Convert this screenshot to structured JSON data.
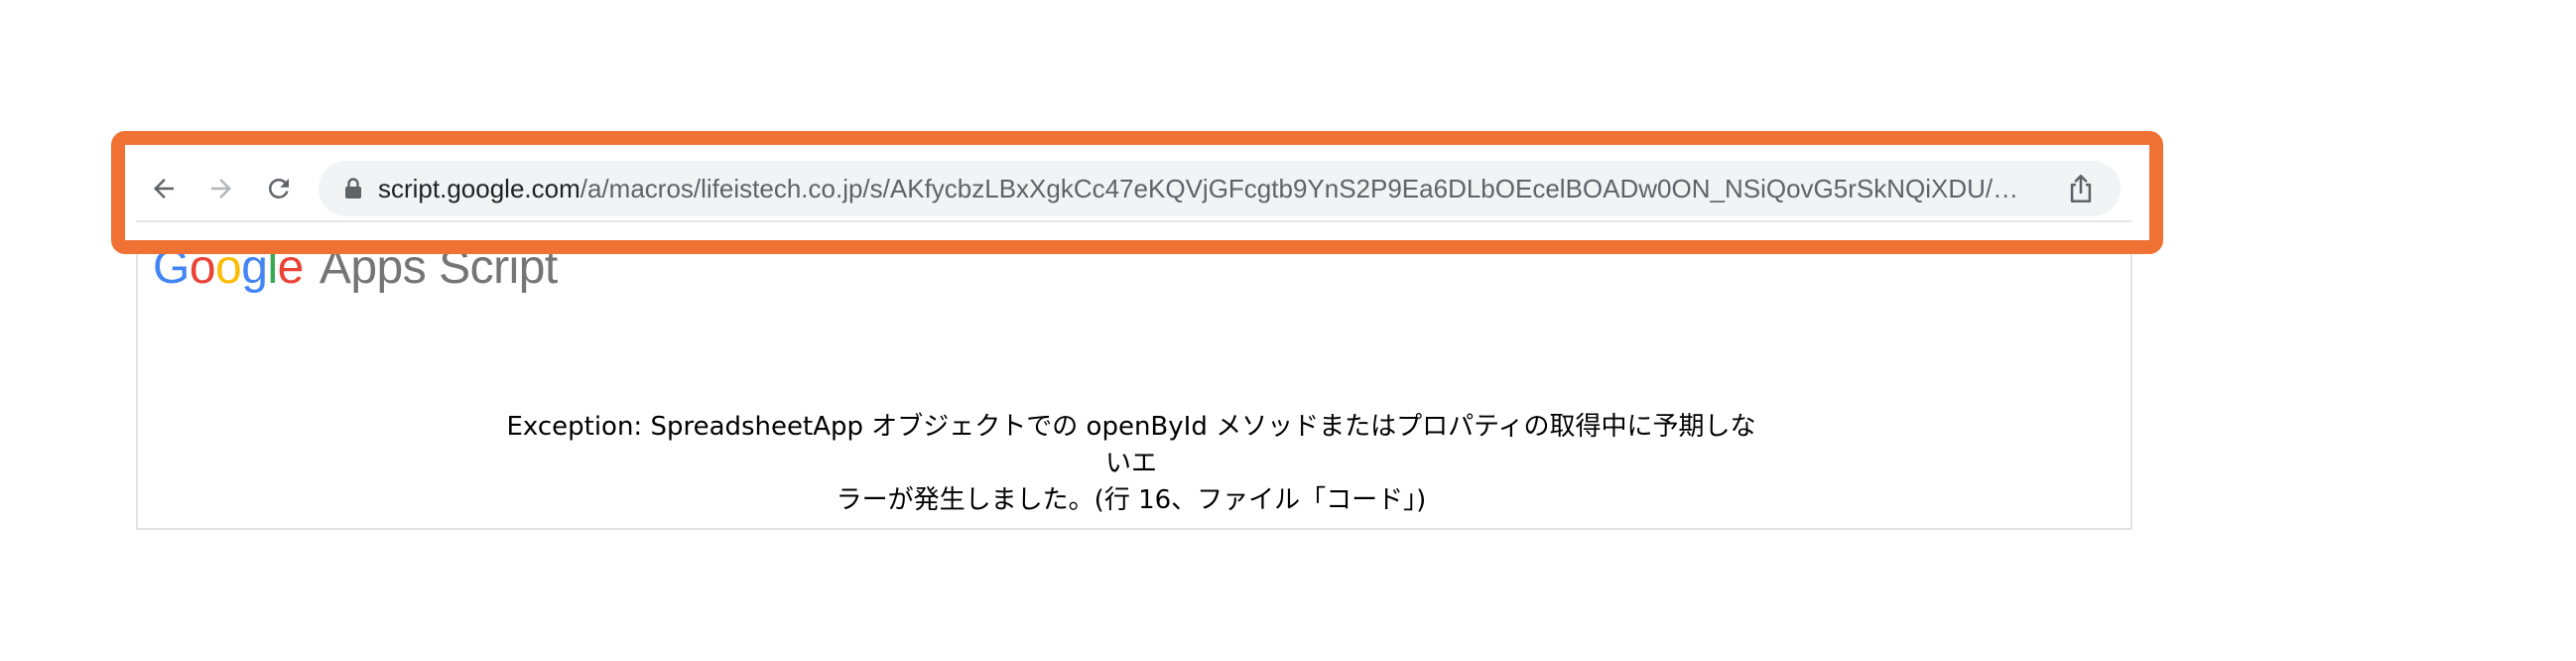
{
  "browser": {
    "url_host": "script.google.com",
    "url_path": "/a/macros/lifeistech.co.jp/s/AKfycbzLBxXgkCc47eKQVjGFcgtb9YnS2P9Ea6DLbOEcelBOADw0ON_NSiQovG5rSkNQiXDU/e...",
    "icons": {
      "back": "arrow-left-icon",
      "forward": "arrow-right-icon",
      "reload": "reload-icon",
      "lock": "lock-icon",
      "share": "share-icon"
    },
    "highlight_color": "#EF7234"
  },
  "page": {
    "logo": {
      "letters": [
        "G",
        "o",
        "o",
        "g",
        "l",
        "e"
      ],
      "product": "Apps Script"
    },
    "error": {
      "line1": "Exception: SpreadsheetApp オブジェクトでの openById メソッドまたはプロパティの取得中に予期しないエ",
      "line2": "ラーが発生しました。(行 16、ファイル「コード」)"
    }
  }
}
